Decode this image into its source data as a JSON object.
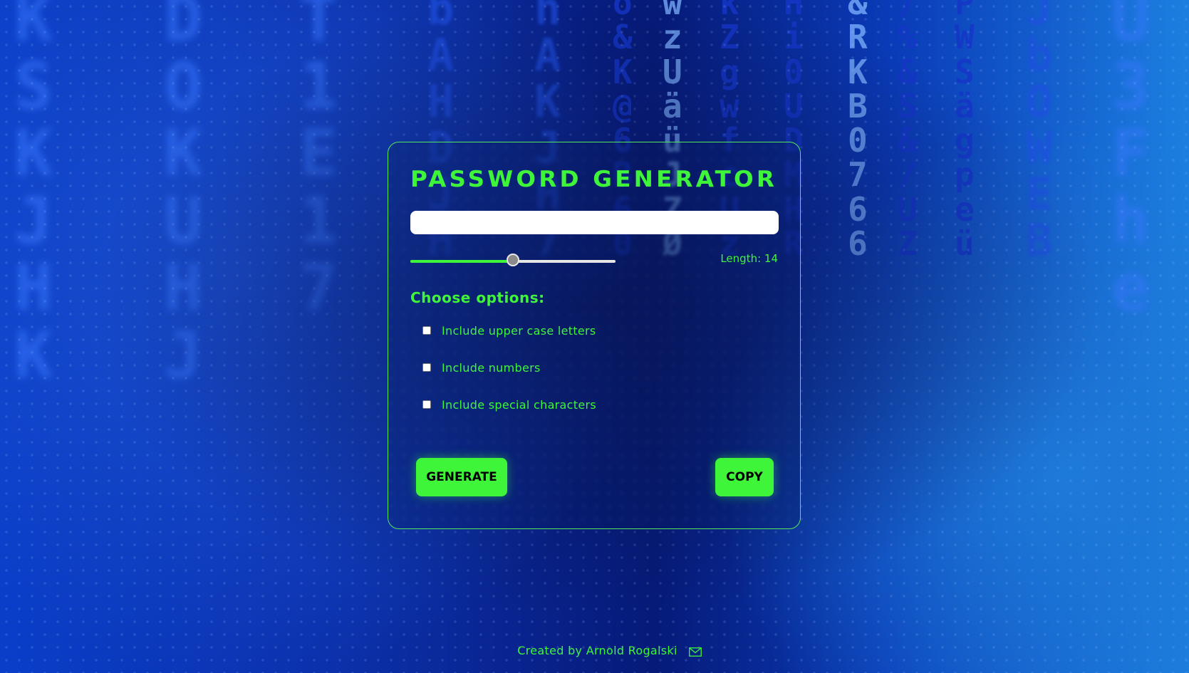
{
  "app": {
    "title": "PASSWORD GENERATOR"
  },
  "password": {
    "value": "",
    "placeholder": ""
  },
  "length": {
    "label": "Length: 14",
    "value": 14,
    "slider_fraction": 0.5
  },
  "options": {
    "heading": "Choose options:",
    "items": [
      {
        "label": "Include upper case letters",
        "checked": false
      },
      {
        "label": "Include numbers",
        "checked": false
      },
      {
        "label": "Include special characters",
        "checked": false
      }
    ]
  },
  "buttons": {
    "generate_label": "GENERATE",
    "copy_label": "COPY"
  },
  "footer": {
    "credit": "Created by Arnold Rogalski",
    "icon": "mail-icon"
  },
  "colors": {
    "accent": "#3ff53a",
    "background": "#0b2fa8",
    "input_bg": "#ffffff",
    "button_text": "#000000"
  }
}
